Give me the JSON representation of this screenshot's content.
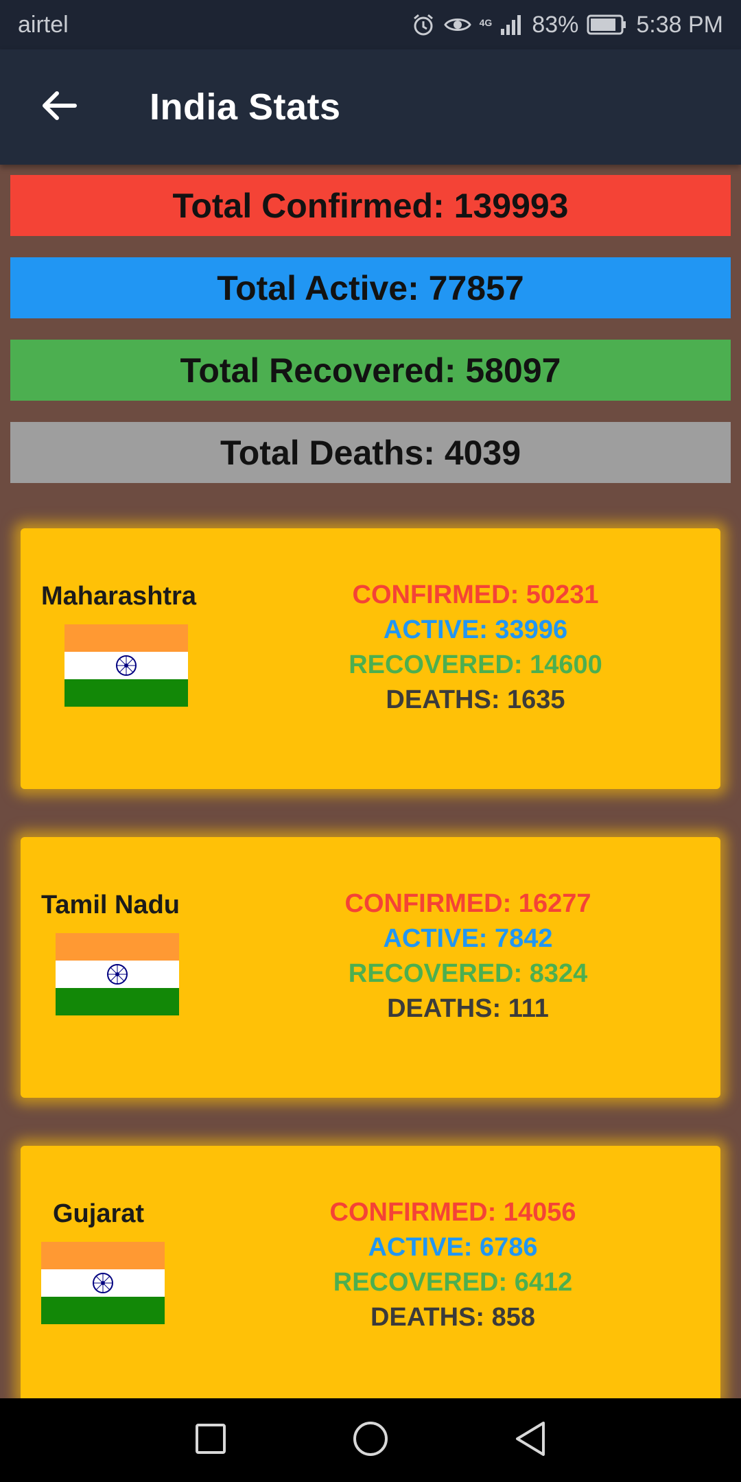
{
  "status_bar": {
    "carrier": "airtel",
    "network": "4G",
    "battery": "83%",
    "time": "5:38 PM"
  },
  "app_bar": {
    "title": "India Stats"
  },
  "totals": {
    "confirmed": "Total Confirmed: 139993",
    "active": "Total Active: 77857",
    "recovered": "Total Recovered: 58097",
    "deaths": "Total Deaths: 4039"
  },
  "colors": {
    "confirmed": "#f44336",
    "active": "#2196f3",
    "recovered": "#4caf50",
    "deaths": "#9e9e9e",
    "card": "#ffc107",
    "background": "#6d4c41"
  },
  "states": [
    {
      "name": "Maharashtra",
      "confirmed": "CONFIRMED: 50231",
      "active": "ACTIVE: 33996",
      "recovered": "RECOVERED: 14600",
      "deaths": "DEATHS: 1635"
    },
    {
      "name": "Tamil Nadu",
      "confirmed": "CONFIRMED: 16277",
      "active": "ACTIVE: 7842",
      "recovered": "RECOVERED: 8324",
      "deaths": "DEATHS: 111"
    },
    {
      "name": "Gujarat",
      "confirmed": "CONFIRMED: 14056",
      "active": "ACTIVE: 6786",
      "recovered": "RECOVERED: 6412",
      "deaths": "DEATHS: 858"
    }
  ],
  "icons": {
    "back": "arrow-left-icon",
    "alarm": "alarm-icon",
    "eye": "eye-icon",
    "signal": "signal-icon",
    "battery": "battery-icon",
    "flag": "india-flag-icon",
    "nav_recents": "square-icon",
    "nav_home": "circle-icon",
    "nav_back": "triangle-back-icon"
  }
}
